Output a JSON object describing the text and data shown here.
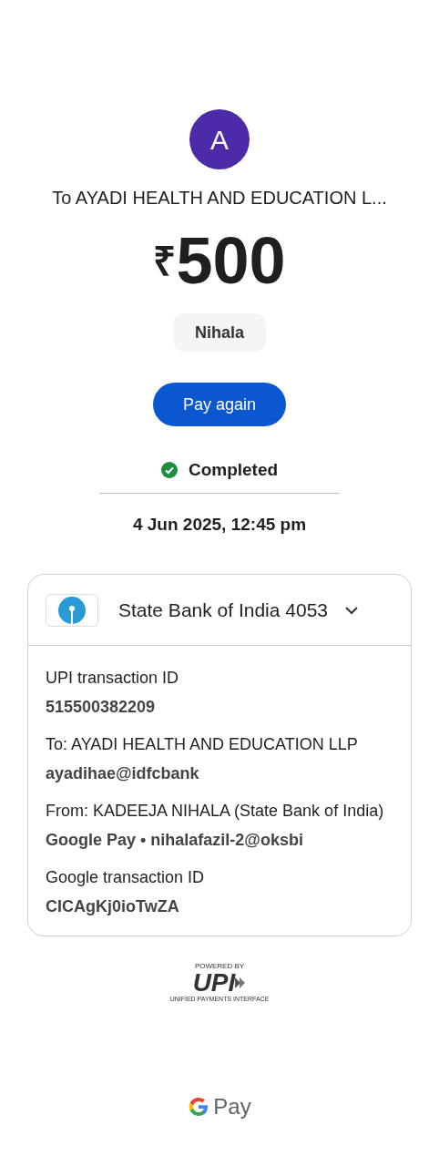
{
  "avatar": {
    "letter": "A",
    "color": "#4c2aa8"
  },
  "recipient_title": "To AYADI HEALTH AND EDUCATION L...",
  "amount": {
    "currency": "₹",
    "value": "500"
  },
  "note": "Nihala",
  "pay_again_button": "Pay again",
  "status": {
    "label": "Completed",
    "kind": "success"
  },
  "date_time": "4 Jun 2025, 12:45 pm",
  "details_card": {
    "account": {
      "bank": "State Bank of India 4053",
      "expanded": true
    },
    "items": [
      {
        "label": "UPI transaction ID",
        "value": "515500382209"
      },
      {
        "label": "To: AYADI HEALTH AND EDUCATION LLP",
        "value": "ayadihae@idfcbank"
      },
      {
        "label": "From: KADEEJA  NIHALA (State Bank of India)",
        "value": "Google Pay • nihalafazil-2@oksbi"
      },
      {
        "label": "Google transaction ID",
        "value": "CICAgKj0ioTwZA"
      }
    ]
  },
  "upi_logo": {
    "powered_by": "POWERED BY",
    "mark": "UPI",
    "tagline": "UNIFIED PAYMENTS INTERFACE"
  },
  "footer_logo": {
    "text": "Pay"
  }
}
